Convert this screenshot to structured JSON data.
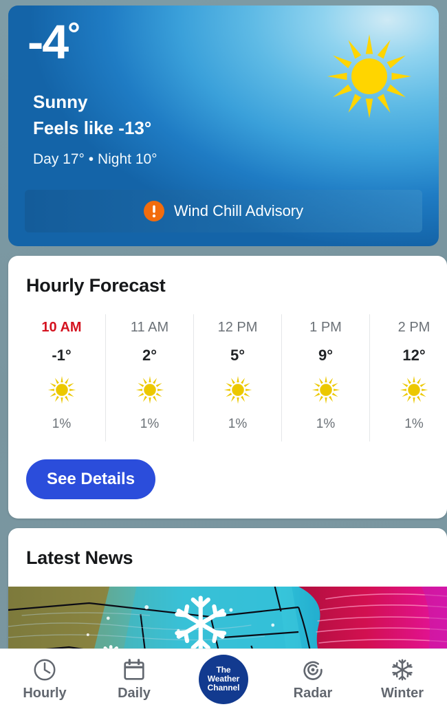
{
  "hero": {
    "temperature": "-4",
    "degree_symbol": "°",
    "condition": "Sunny",
    "feels_like": "Feels like -13°",
    "day_night": "Day 17° • Night 10°",
    "icon": "sun-icon",
    "alert": {
      "icon": "alert-exclamation-icon",
      "label": "Wind Chill Advisory"
    },
    "colors": {
      "gradient_light": "#8fd3ef",
      "gradient_dark": "#1464a8",
      "alert_icon": "#f26c0d"
    }
  },
  "hourly": {
    "title": "Hourly Forecast",
    "see_details_label": "See Details",
    "button_color": "#2b4ddb",
    "now_color": "#d4121f",
    "columns": [
      {
        "time": "10 AM",
        "temp": "-1°",
        "icon": "sun-icon",
        "precip": "1%",
        "is_now": true
      },
      {
        "time": "11 AM",
        "temp": "2°",
        "icon": "sun-icon",
        "precip": "1%",
        "is_now": false
      },
      {
        "time": "12 PM",
        "temp": "5°",
        "icon": "sun-icon",
        "precip": "1%",
        "is_now": false
      },
      {
        "time": "1 PM",
        "temp": "9°",
        "icon": "sun-icon",
        "precip": "1%",
        "is_now": false
      },
      {
        "time": "2 PM",
        "temp": "12°",
        "icon": "sun-icon",
        "precip": "1%",
        "is_now": false
      }
    ]
  },
  "news": {
    "title": "Latest News",
    "image_alt": "winter-storm-weather-map"
  },
  "bottom_nav": {
    "items": [
      {
        "label": "Hourly",
        "icon": "clock-icon"
      },
      {
        "label": "Daily",
        "icon": "calendar-icon"
      },
      {
        "label": "",
        "icon": "weather-channel-logo"
      },
      {
        "label": "Radar",
        "icon": "radar-icon"
      },
      {
        "label": "Winter",
        "icon": "snowflake-icon"
      }
    ],
    "brand": {
      "line1": "The",
      "line2": "Weather",
      "line3": "Channel",
      "color": "#123a8f"
    }
  }
}
